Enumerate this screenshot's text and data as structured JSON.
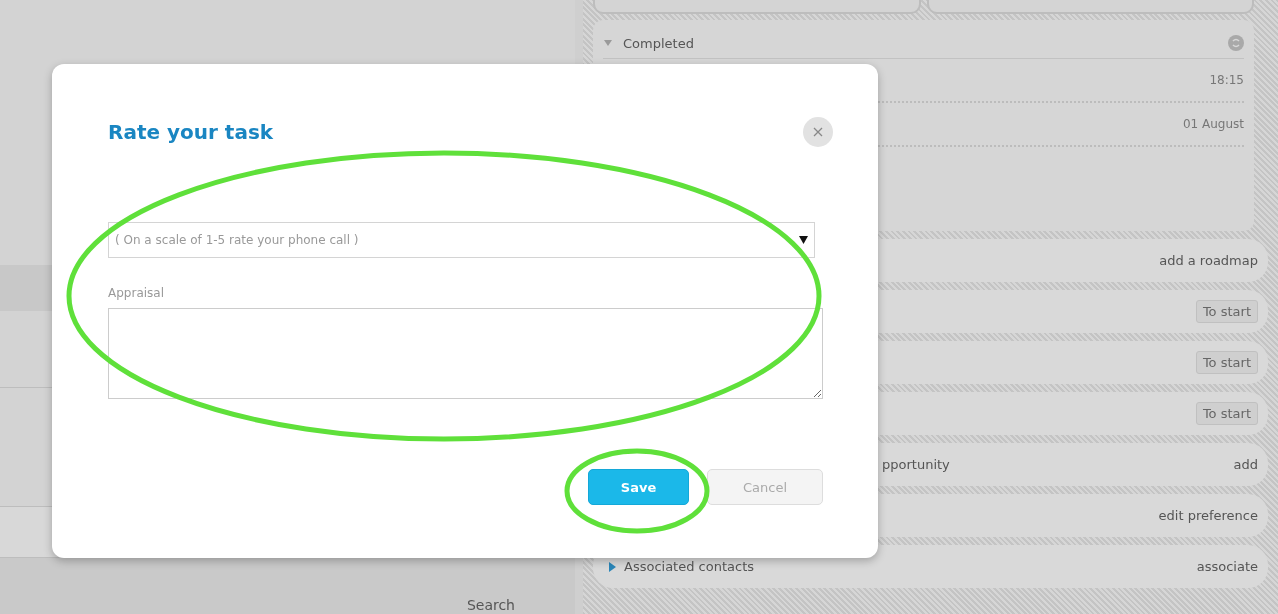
{
  "background": {
    "search_label": "Search",
    "completed": {
      "title": "Completed",
      "expanded": true,
      "items": [
        "18:15",
        "01 August"
      ]
    },
    "sections": [
      {
        "action": "add a roadmap",
        "kind": "link"
      },
      {
        "action": "To start",
        "kind": "button"
      },
      {
        "action": "To start",
        "kind": "button"
      },
      {
        "action": "To start",
        "kind": "button"
      },
      {
        "label": "pportunity",
        "action": "add",
        "kind": "link"
      },
      {
        "action": "edit preference",
        "kind": "link"
      },
      {
        "label": "Associated contacts",
        "action": "associate",
        "kind": "link",
        "expanded": false
      }
    ]
  },
  "dialog": {
    "title": "Rate your task",
    "rating_select": {
      "placeholder": "( On a scale of 1-5 rate your phone call )"
    },
    "appraisal": {
      "label": "Appraisal"
    },
    "buttons": [
      {
        "label": "Save",
        "kind": "primary"
      },
      {
        "label": "Cancel",
        "kind": "secondary"
      }
    ]
  }
}
